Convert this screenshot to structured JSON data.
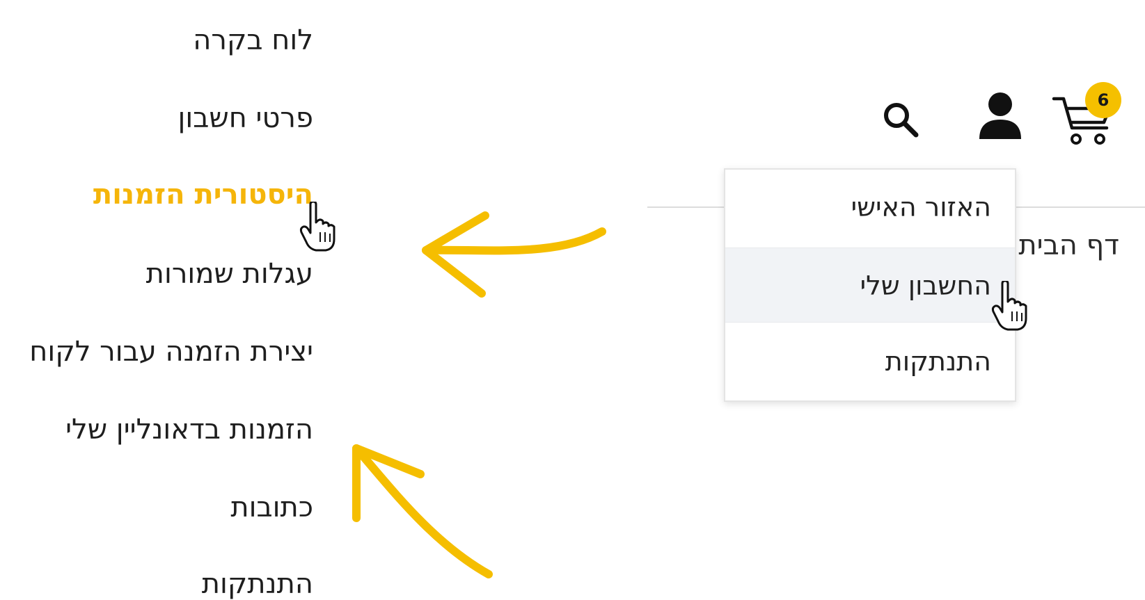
{
  "account_nav": {
    "items": [
      {
        "label": "לוח בקרה",
        "active": false
      },
      {
        "label": "פרטי חשבון",
        "active": false
      },
      {
        "label": "היסטורית הזמנות",
        "active": true
      },
      {
        "label": "עגלות שמורות",
        "active": false
      },
      {
        "label": "יצירת הזמנה עבור לקוח",
        "active": false
      },
      {
        "label": "הזמנות בדאונליין שלי",
        "active": false
      },
      {
        "label": "כתובות",
        "active": false
      },
      {
        "label": "התנתקות",
        "active": false
      }
    ]
  },
  "header": {
    "cart_count": "6",
    "breadcrumb": "דף הבית",
    "icons": [
      "search-icon",
      "user-icon",
      "cart-icon"
    ]
  },
  "user_dropdown": {
    "items": [
      {
        "label": "האזור האישי"
      },
      {
        "label": "החשבון שלי",
        "hovered": true
      },
      {
        "label": "התנתקות"
      }
    ]
  },
  "colors": {
    "accent": "#f5b50a",
    "badge": "#f5c000",
    "text": "#1e1e1e",
    "menu_hover": "#f1f3f6"
  }
}
